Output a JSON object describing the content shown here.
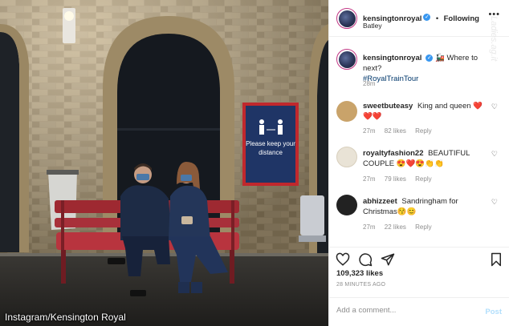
{
  "photo": {
    "credit": "Instagram/Kensington Royal",
    "sign_text": "Please keep your distance"
  },
  "header": {
    "username": "kensingtonroyal",
    "follow_label": "Following",
    "location": "Batley",
    "separator": "•",
    "more_icon": "more-horizontal-icon"
  },
  "watermark": "Ladies.ag.it",
  "caption": {
    "username": "kensingtonroyal",
    "text": "🚂 Where to next?",
    "hashtag": "#RoyalTrainTour",
    "age": "28m"
  },
  "comments": [
    {
      "username": "sweetbuteasy",
      "text": "King and queen ❤️❤️❤️",
      "age": "27m",
      "likes": "82 likes",
      "reply": "Reply",
      "avatar_color": "#c9a36a"
    },
    {
      "username": "royaltyfashion22",
      "text": "BEAUTIFUL COUPLE 😍❤️😍👏👏",
      "age": "27m",
      "likes": "79 likes",
      "reply": "Reply",
      "avatar_color": "#e9e3d6"
    },
    {
      "username": "abhizzeet",
      "text": "Sandringham for Christmas😚😊",
      "age": "27m",
      "likes": "22 likes",
      "reply": "Reply",
      "avatar_color": "#222222"
    }
  ],
  "actions": {
    "like_icon": "heart-icon",
    "comment_icon": "comment-icon",
    "share_icon": "share-icon",
    "save_icon": "bookmark-icon"
  },
  "likes": "109,323 likes",
  "posted_ago": "28 MINUTES AGO",
  "add_comment": {
    "placeholder": "Add a comment...",
    "post_label": "Post"
  },
  "colors": {
    "verified": "#3897f0",
    "hashtag": "#00376b",
    "post_disabled": "#b2dffc",
    "heart_red": "#ed4956"
  }
}
